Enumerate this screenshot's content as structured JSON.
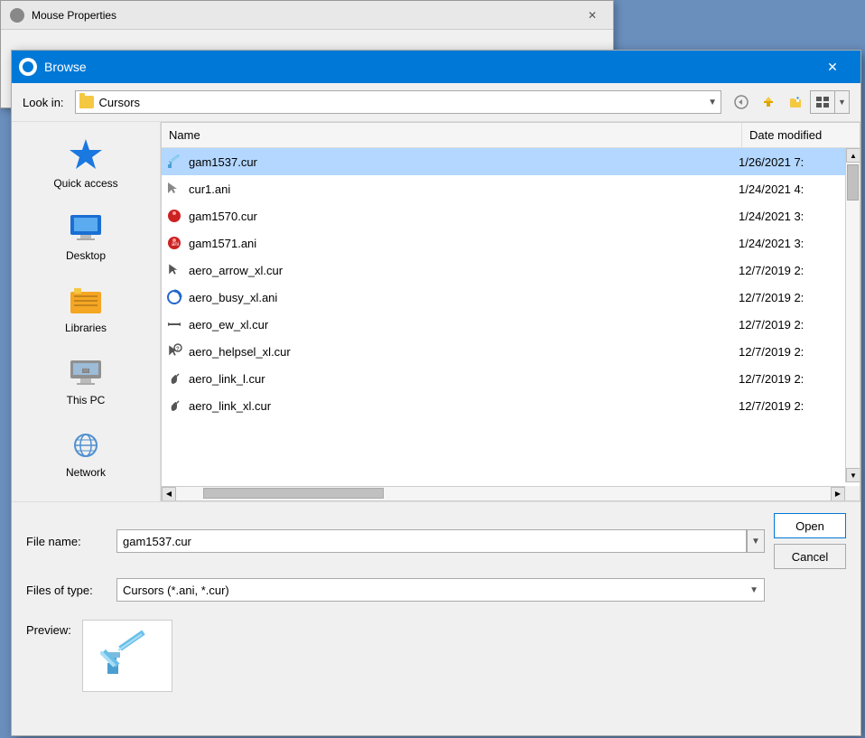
{
  "mouse_window": {
    "title": "Mouse Properties",
    "close_label": "✕"
  },
  "browse_dialog": {
    "title": "Browse",
    "close_label": "✕",
    "toolbar": {
      "look_in_label": "Look in:",
      "look_in_value": "Cursors",
      "look_in_folder_icon": "folder-icon",
      "back_btn": "←",
      "up_btn": "↑",
      "create_folder_btn": "📁",
      "views_btn": "⊞",
      "views_arrow": "▼"
    },
    "sidebar": {
      "items": [
        {
          "id": "quick-access",
          "label": "Quick access",
          "icon": "star"
        },
        {
          "id": "desktop",
          "label": "Desktop",
          "icon": "desktop"
        },
        {
          "id": "libraries",
          "label": "Libraries",
          "icon": "libraries"
        },
        {
          "id": "this-pc",
          "label": "This PC",
          "icon": "computer"
        },
        {
          "id": "network",
          "label": "Network",
          "icon": "network"
        }
      ]
    },
    "file_list": {
      "columns": [
        {
          "id": "name",
          "label": "Name"
        },
        {
          "id": "date",
          "label": "Date modified"
        }
      ],
      "files": [
        {
          "name": "gam1537.cur",
          "date": "1/26/2021 7:",
          "icon": "sword",
          "selected": true
        },
        {
          "name": "cur1.ani",
          "date": "1/24/2021 4:",
          "icon": "ani"
        },
        {
          "name": "gam1570.cur",
          "date": "1/24/2021 3:",
          "icon": "red-character"
        },
        {
          "name": "gam1571.ani",
          "date": "1/24/2021 3:",
          "icon": "red-character2"
        },
        {
          "name": "aero_arrow_xl.cur",
          "date": "12/7/2019 2:",
          "icon": "arrow"
        },
        {
          "name": "aero_busy_xl.ani",
          "date": "12/7/2019 2:",
          "icon": "busy"
        },
        {
          "name": "aero_ew_xl.cur",
          "date": "12/7/2019 2:",
          "icon": "ew"
        },
        {
          "name": "aero_helpsel_xl.cur",
          "date": "12/7/2019 2:",
          "icon": "helpsel"
        },
        {
          "name": "aero_link_l.cur",
          "date": "12/7/2019 2:",
          "icon": "link"
        },
        {
          "name": "aero_link_xl.cur",
          "date": "12/7/2019 2:",
          "icon": "link2"
        }
      ]
    },
    "bottom": {
      "file_name_label": "File name:",
      "file_name_value": "gam1537.cur",
      "files_of_type_label": "Files of type:",
      "files_of_type_value": "Cursors (*.ani, *.cur)",
      "open_btn": "Open",
      "cancel_btn": "Cancel"
    },
    "preview": {
      "label": "Preview:",
      "icon": "sword-cursor"
    }
  }
}
